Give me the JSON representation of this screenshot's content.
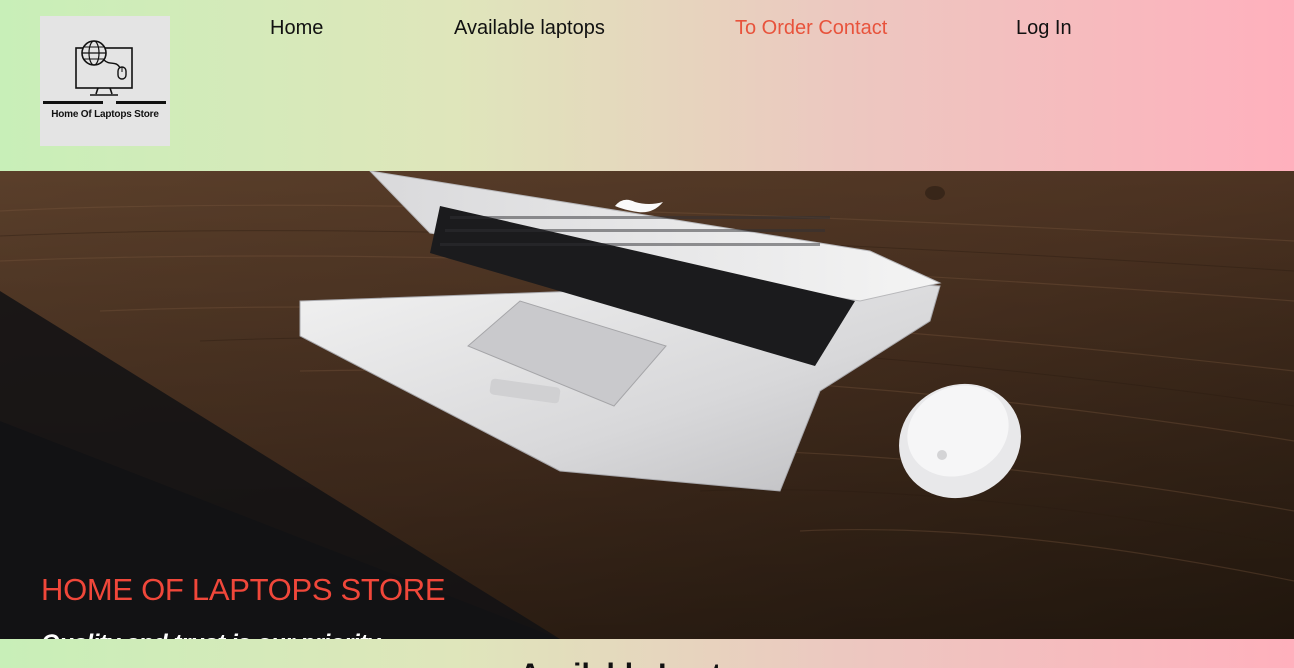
{
  "brand": {
    "logo_text": "Home Of Laptops Store"
  },
  "nav": {
    "items": [
      {
        "label": "Home"
      },
      {
        "label": "Available laptops"
      },
      {
        "label": "To Order Contact"
      },
      {
        "label": "Log In"
      }
    ],
    "active_index": 2
  },
  "hero": {
    "title": "HOME OF LAPTOPS STORE",
    "subtitle": "Quality and trust is our priority"
  },
  "section": {
    "heading": "Available Laptops"
  },
  "colors": {
    "accent": "#e8533c",
    "hero_title": "#f0473a",
    "gradient_left": "#c8efb8",
    "gradient_right": "#ffb0bd"
  },
  "icons": [
    "computer-globe-icon"
  ]
}
